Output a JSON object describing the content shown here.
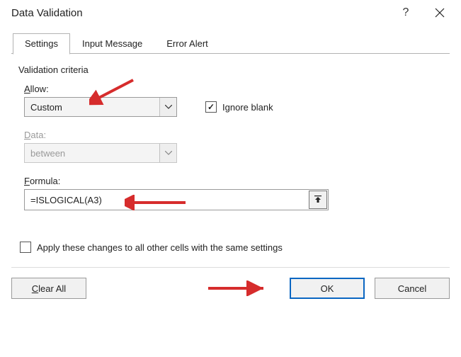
{
  "title": "Data Validation",
  "tabs": {
    "settings": "Settings",
    "input_message": "Input Message",
    "error_alert": "Error Alert"
  },
  "section": {
    "criteria_title": "Validation criteria",
    "allow_label_pre": "A",
    "allow_label_post": "llow:",
    "allow_value": "Custom",
    "ignore_blank_pre": "I",
    "ignore_blank_post": "gnore blank",
    "data_label_pre": "D",
    "data_label_post": "ata:",
    "data_value": "between",
    "formula_label_pre": "F",
    "formula_label_post": "ormula:",
    "formula_value": "=ISLOGICAL(A3)",
    "apply_all_pre": "A",
    "apply_all_mid": "pply these changes to all other cells with the same settings"
  },
  "buttons": {
    "clear_pre": "C",
    "clear_post": "lear All",
    "ok": "OK",
    "cancel": "Cancel"
  }
}
